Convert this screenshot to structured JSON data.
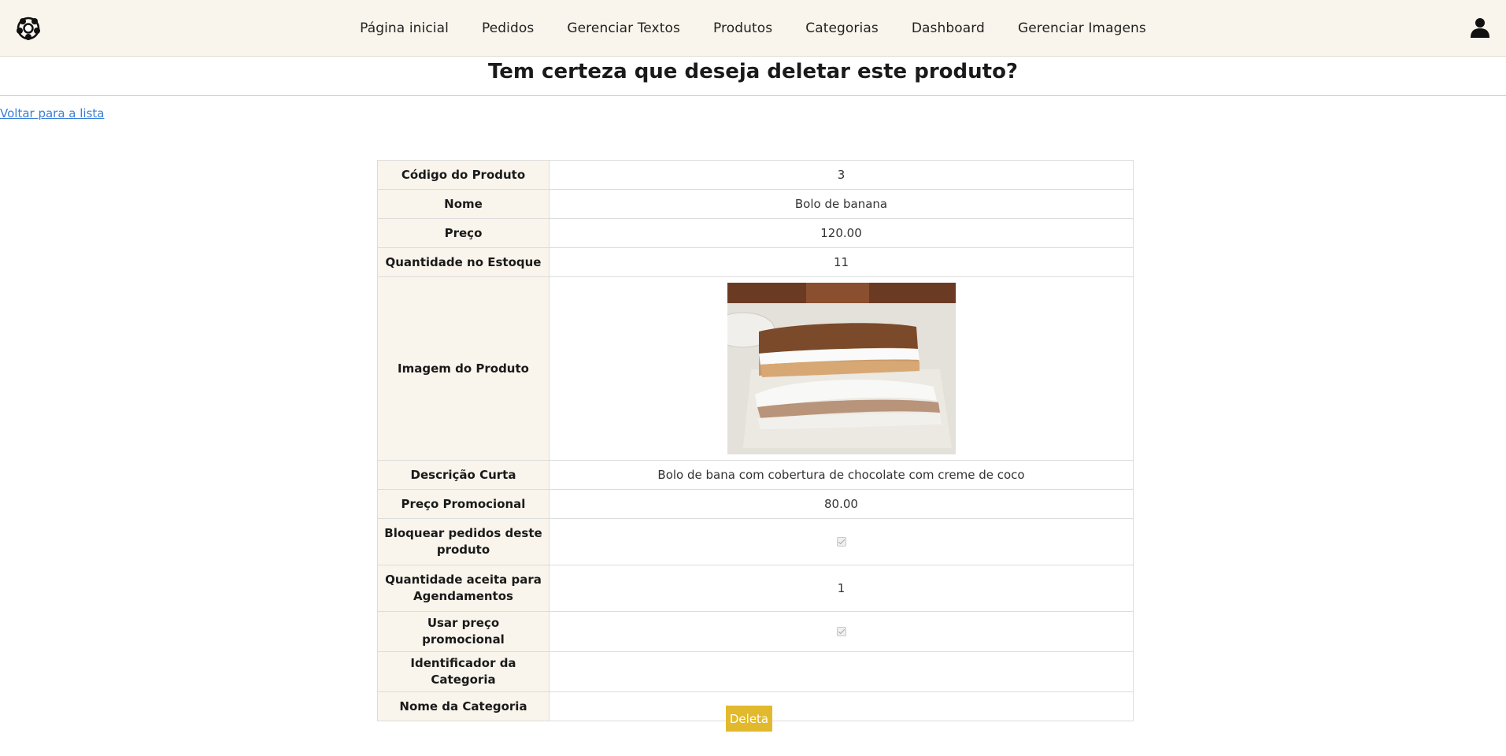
{
  "nav": {
    "links": [
      "Página inicial",
      "Pedidos",
      "Gerenciar Textos",
      "Produtos",
      "Categorias",
      "Dashboard",
      "Gerenciar Imagens"
    ]
  },
  "page": {
    "title": "Tem certeza que deseja deletar este produto?",
    "back_link": "Voltar para a lista",
    "delete_button": "Deleta"
  },
  "product": {
    "codigo_label": "Código do Produto",
    "codigo_value": "3",
    "nome_label": "Nome",
    "nome_value": "Bolo de banana",
    "preco_label": "Preço",
    "preco_value": "120.00",
    "estoque_label": "Quantidade no Estoque",
    "estoque_value": "11",
    "imagem_label": "Imagem do Produto",
    "descricao_label": "Descrição Curta",
    "descricao_value": "Bolo de bana com cobertura de chocolate com creme de coco",
    "promo_label": "Preço Promocional",
    "promo_value": "80.00",
    "bloquear_label": "Bloquear pedidos deste produto",
    "bloquear_checked": true,
    "agendamentos_label": "Quantidade aceita para Agendamentos",
    "agendamentos_value": "1",
    "usar_promo_label": "Usar preço promocional",
    "usar_promo_checked": true,
    "cat_id_label": "Identificador da Categoria",
    "cat_id_value": "",
    "cat_nome_label": "Nome da Categoria",
    "cat_nome_value": ""
  },
  "colors": {
    "accent": "#e2b92c",
    "nav_bg": "#f9f5ec",
    "link": "#3b7fd6"
  }
}
